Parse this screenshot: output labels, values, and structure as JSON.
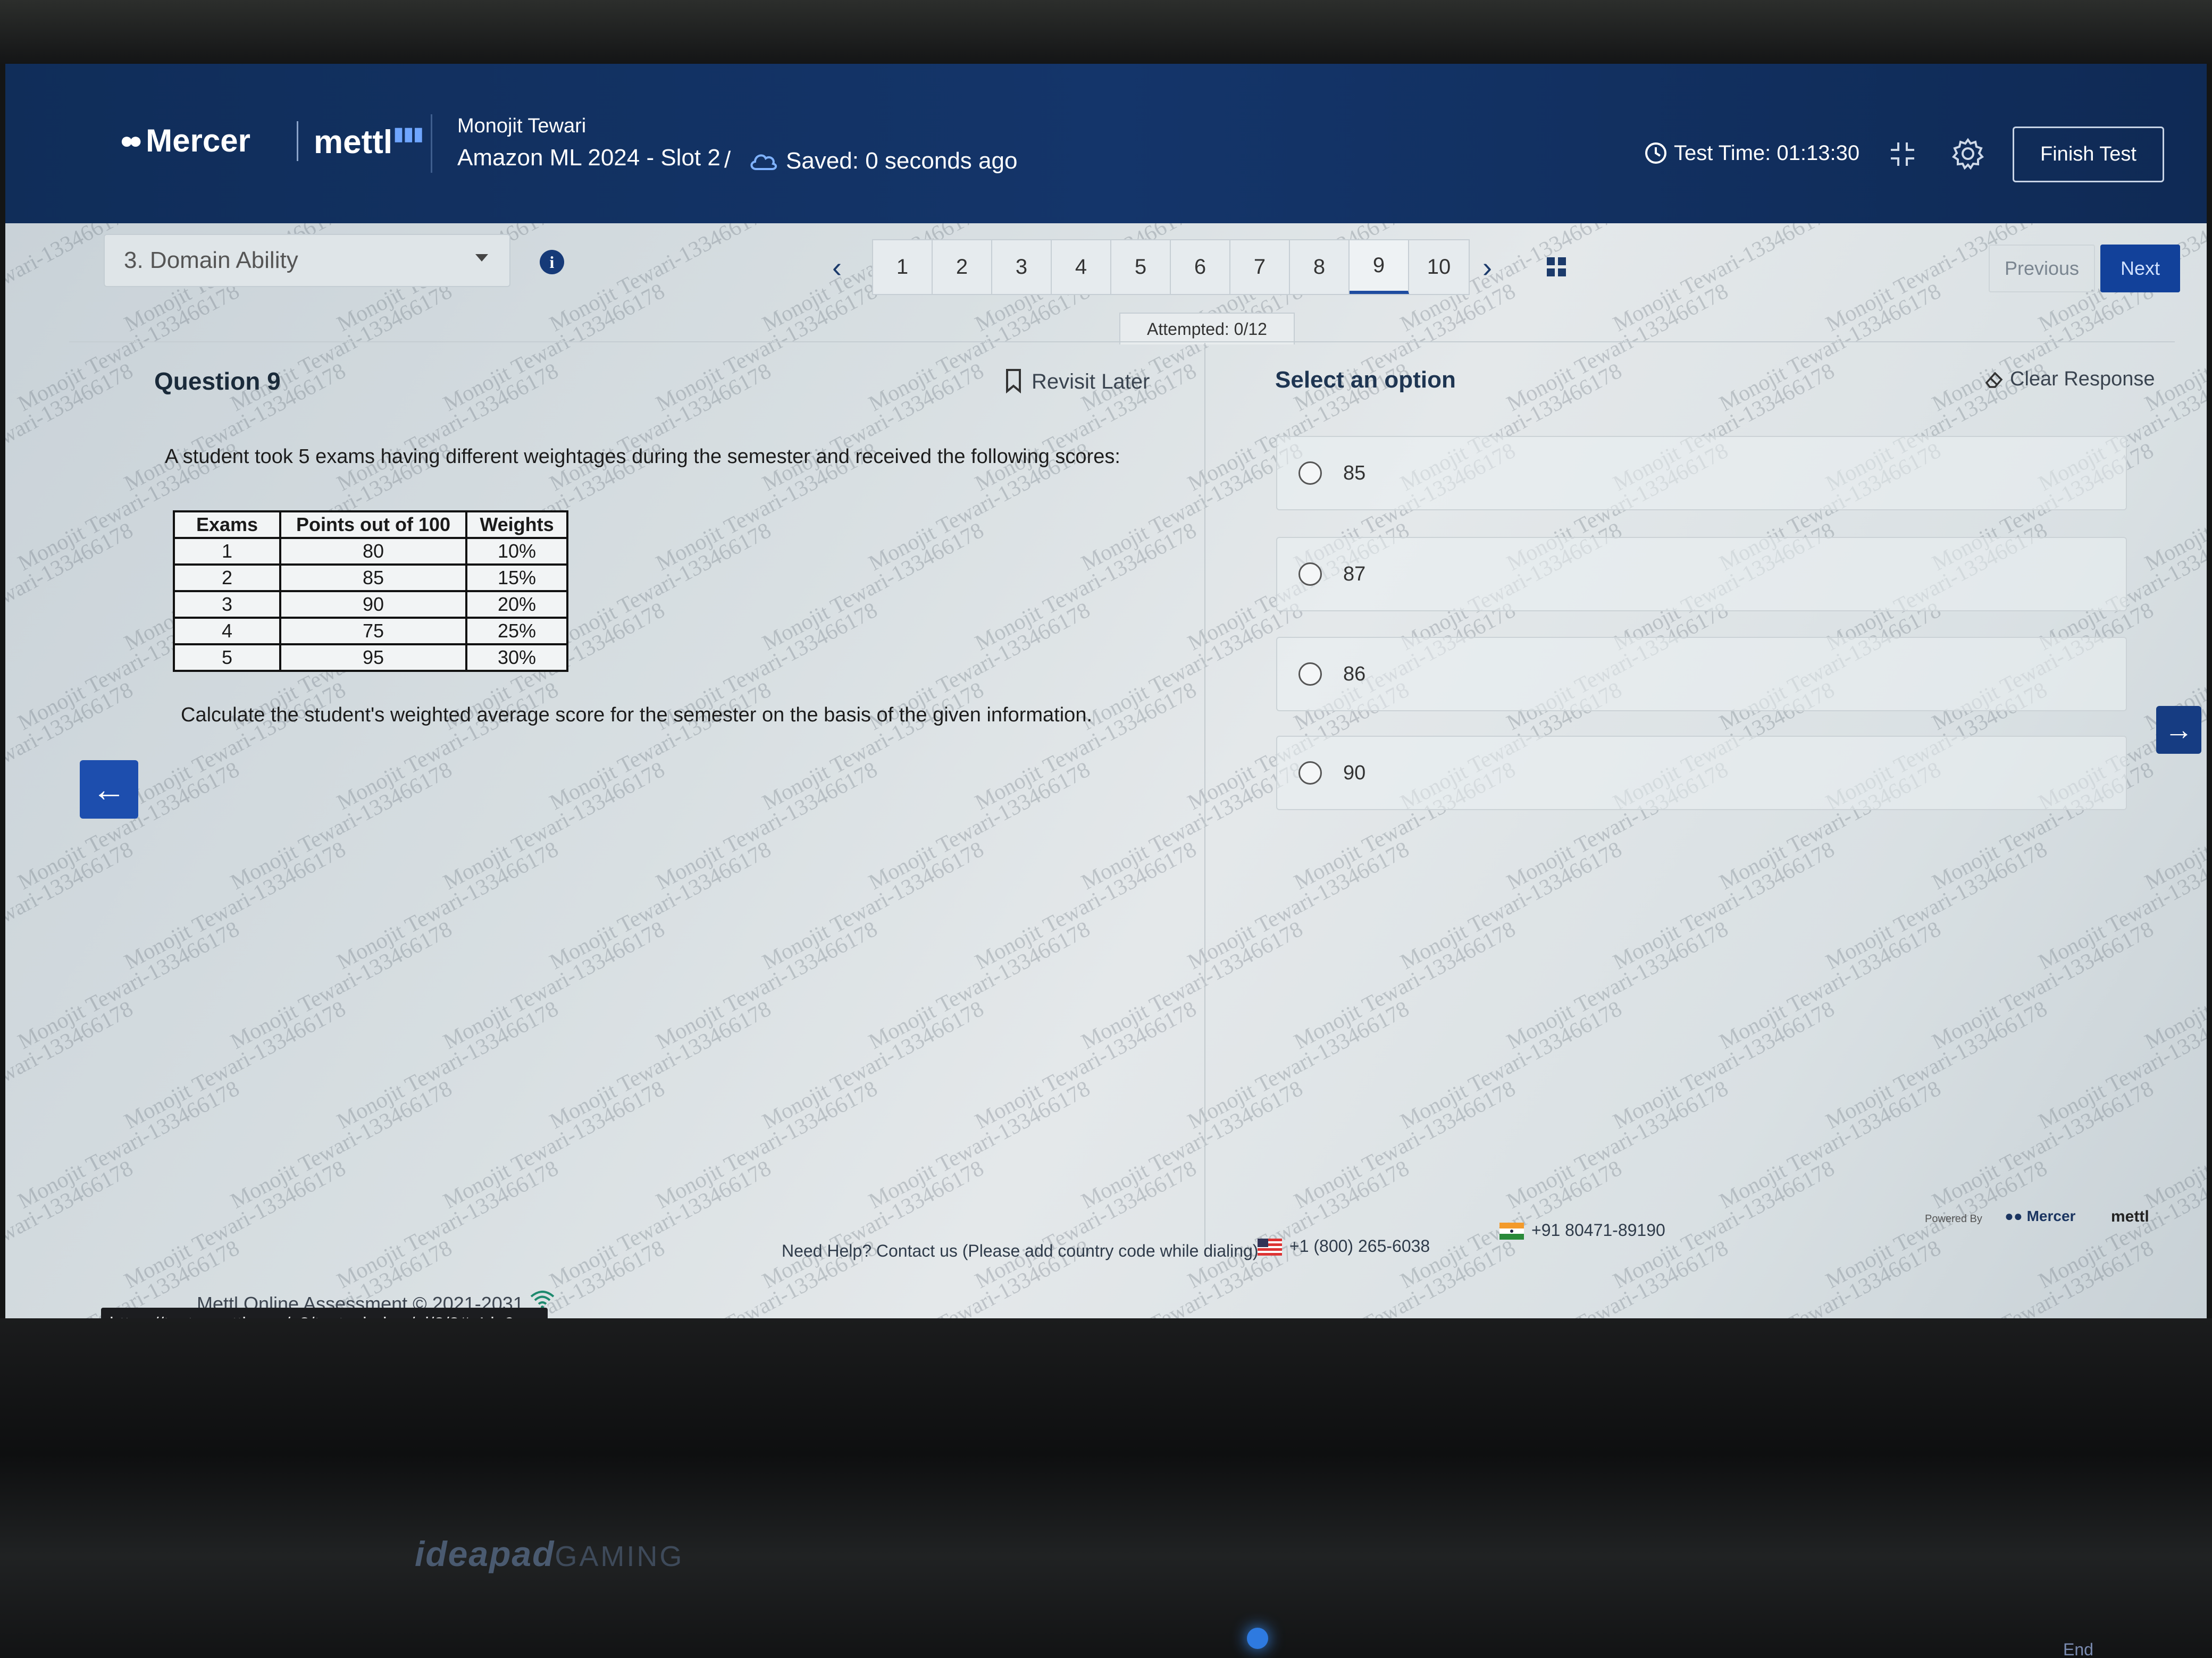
{
  "header": {
    "logo_mercer": "Mercer",
    "logo_mettl": "mettl",
    "user_name": "Monojit Tewari",
    "test_name": "Amazon ML 2024 - Slot 2",
    "separator": "/",
    "saved_status": "Saved: 0 seconds ago",
    "test_time": "Test Time: 01:13:30",
    "finish_label": "Finish Test"
  },
  "nav": {
    "section": "3. Domain Ability",
    "questions": [
      "1",
      "2",
      "3",
      "4",
      "5",
      "6",
      "7",
      "8",
      "9",
      "10"
    ],
    "active_question": "9",
    "previous_label": "Previous",
    "next_label": "Next",
    "attempted": "Attempted: 0/12"
  },
  "question": {
    "title": "Question 9",
    "revisit_label": "Revisit Later",
    "text": "A student took 5 exams having different weightages during the semester and received the following scores:",
    "ask": "Calculate the student's weighted average score for the semester on the basis of the given information.",
    "table": {
      "headers": [
        "Exams",
        "Points out of 100",
        "Weights"
      ],
      "rows": [
        [
          "1",
          "80",
          "10%"
        ],
        [
          "2",
          "85",
          "15%"
        ],
        [
          "3",
          "90",
          "20%"
        ],
        [
          "4",
          "75",
          "25%"
        ],
        [
          "5",
          "95",
          "30%"
        ]
      ]
    }
  },
  "answers": {
    "title": "Select an option",
    "clear_label": "Clear Response",
    "options": [
      "85",
      "87",
      "86",
      "90"
    ]
  },
  "footer": {
    "help": "Need Help? Contact us (Please add country code while dialing)",
    "us_phone": "+1 (800) 265-6038",
    "in_phone": "+91 80471-89190",
    "powered_by": "Powered By",
    "powered_mercer": "Mercer",
    "powered_mettl": "mettl",
    "copyright": "Mettl Online Assessment © 2021-2031",
    "url": "https://tests.mettl.com/v2/test-window/pi/2/8#qId_9"
  },
  "watermark_text": "Monojit Tewari-133466178",
  "laptop": {
    "brand": "ideapad",
    "brand_suffix": "GAMING",
    "key_label": "End"
  },
  "colors": {
    "header_bg": "#14356a",
    "accent": "#12419a",
    "panel_bg": "#e0e5e8"
  },
  "icons": [
    "cloud-icon",
    "clock-icon",
    "collapse-icon",
    "gear-icon",
    "info-icon",
    "grid-icon",
    "bookmark-icon",
    "eraser-icon",
    "wifi-icon",
    "arrow-left-icon",
    "arrow-right-icon"
  ]
}
